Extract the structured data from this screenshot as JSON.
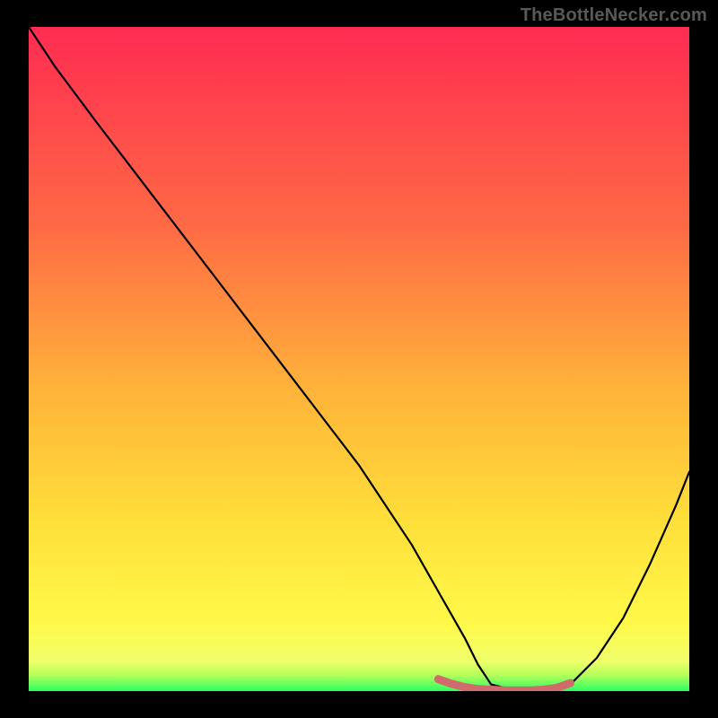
{
  "watermark": "TheBottleNecker.com",
  "chart_data": {
    "type": "line",
    "title": "",
    "xlabel": "",
    "ylabel": "",
    "xlim": [
      0,
      100
    ],
    "ylim": [
      0,
      100
    ],
    "background_gradient": {
      "top": "#ff2b52",
      "mid_upper": "#ff8a3a",
      "mid_lower": "#ffe63a",
      "bottom_band": "#f6ff7a",
      "baseline": "#2cff63"
    },
    "series": [
      {
        "name": "bottleneck-curve",
        "color": "#000000",
        "x": [
          0,
          4,
          10,
          20,
          30,
          40,
          50,
          58,
          62,
          66,
          68,
          70,
          74,
          78,
          82,
          86,
          90,
          94,
          98,
          100
        ],
        "y": [
          100,
          94,
          86,
          73,
          60,
          47,
          34,
          22,
          15,
          8,
          4,
          1,
          0,
          0,
          1,
          5,
          11,
          19,
          28,
          33
        ]
      },
      {
        "name": "sweet-spot-band",
        "color": "#d06a6a",
        "x": [
          62,
          64,
          66,
          68,
          70,
          72,
          74,
          76,
          78,
          80,
          82
        ],
        "y": [
          1.8,
          1.1,
          0.6,
          0.3,
          0.2,
          0.1,
          0.1,
          0.1,
          0.2,
          0.5,
          1.2
        ]
      }
    ],
    "annotations": []
  }
}
